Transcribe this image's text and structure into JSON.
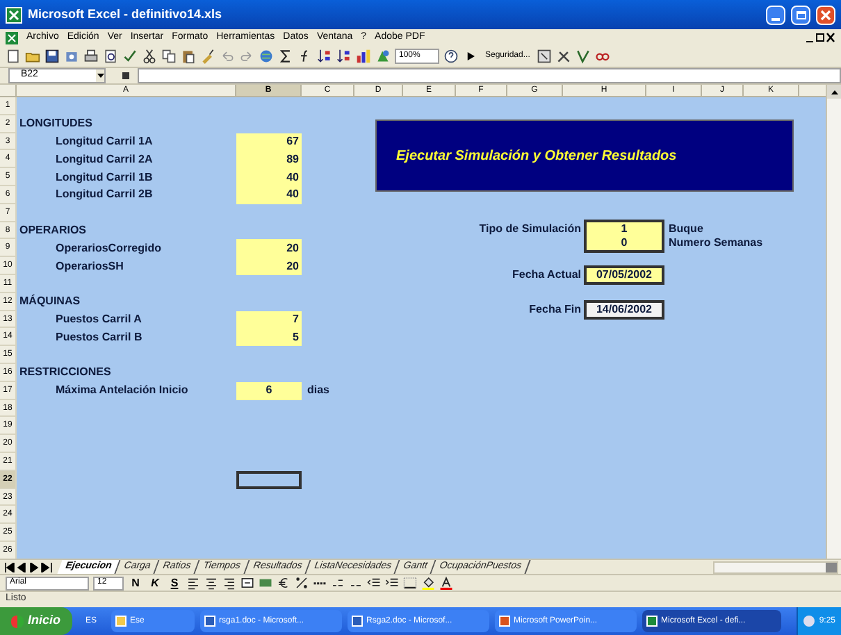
{
  "window": {
    "title": "Microsoft Excel - definitivo14.xls"
  },
  "menu": [
    "Archivo",
    "Edición",
    "Ver",
    "Insertar",
    "Formato",
    "Herramientas",
    "Datos",
    "Ventana",
    "?",
    "Adobe PDF"
  ],
  "toolbar": {
    "zoom": "100%",
    "security": "Seguridad..."
  },
  "formula_bar": {
    "name_box": "B22"
  },
  "columns": [
    {
      "label": "A",
      "selected": false
    },
    {
      "label": "B",
      "selected": true
    },
    {
      "label": "C",
      "selected": false
    },
    {
      "label": "D",
      "selected": false
    },
    {
      "label": "E",
      "selected": false
    },
    {
      "label": "F",
      "selected": false
    },
    {
      "label": "G",
      "selected": false
    },
    {
      "label": "H",
      "selected": false
    },
    {
      "label": "I",
      "selected": false
    },
    {
      "label": "J",
      "selected": false
    },
    {
      "label": "K",
      "selected": false
    }
  ],
  "rows": [
    {
      "number": "1",
      "selected": false
    },
    {
      "number": "2",
      "selected": false,
      "label": "LONGITUDES",
      "kind": "heading"
    },
    {
      "number": "3",
      "selected": false,
      "label": "Longitud Carril 1A",
      "kind": "item",
      "value": "67"
    },
    {
      "number": "4",
      "selected": false,
      "label": "Longitud Carril 2A",
      "kind": "item",
      "value": "89"
    },
    {
      "number": "5",
      "selected": false,
      "label": "Longitud Carril 1B",
      "kind": "item",
      "value": "40"
    },
    {
      "number": "6",
      "selected": false,
      "label": "Longitud Carril 2B",
      "kind": "item",
      "value": "40"
    },
    {
      "number": "7",
      "selected": false
    },
    {
      "number": "8",
      "selected": false,
      "label": "OPERARIOS",
      "kind": "heading"
    },
    {
      "number": "9",
      "selected": false,
      "label": "OperariosCorregido",
      "kind": "item",
      "value": "20"
    },
    {
      "number": "10",
      "selected": false,
      "label": "OperariosSH",
      "kind": "item",
      "value": "20"
    },
    {
      "number": "11",
      "selected": false
    },
    {
      "number": "12",
      "selected": false,
      "label": "MÁQUINAS",
      "kind": "heading"
    },
    {
      "number": "13",
      "selected": false,
      "label": "Puestos Carril A",
      "kind": "item",
      "value": "7"
    },
    {
      "number": "14",
      "selected": false,
      "label": "Puestos Carril B",
      "kind": "item",
      "value": "5"
    },
    {
      "number": "15",
      "selected": false
    },
    {
      "number": "16",
      "selected": false,
      "label": "RESTRICCIONES",
      "kind": "heading"
    },
    {
      "number": "17",
      "selected": false,
      "label": "Máxima Antelación Inicio",
      "kind": "item",
      "value": "6",
      "unit": "dias"
    },
    {
      "number": "18",
      "selected": false
    },
    {
      "number": "19",
      "selected": false
    },
    {
      "number": "20",
      "selected": false
    },
    {
      "number": "21",
      "selected": false
    },
    {
      "number": "22",
      "selected": true
    },
    {
      "number": "23",
      "selected": false
    },
    {
      "number": "24",
      "selected": false
    },
    {
      "number": "25",
      "selected": false
    },
    {
      "number": "26",
      "selected": false
    }
  ],
  "run_button": {
    "label": "Ejecutar Simulación y Obtener Resultados"
  },
  "fields": [
    {
      "label": "Tipo de Simulación",
      "values": [
        "1",
        "0"
      ],
      "notes": [
        "Buque",
        "Numero Semanas"
      ],
      "editable": true
    },
    {
      "label": "Fecha Actual",
      "values": [
        "07/05/2002"
      ],
      "editable": true
    },
    {
      "label": "Fecha Fin",
      "values": [
        "14/06/2002"
      ],
      "editable": false
    }
  ],
  "sheet_tabs": [
    {
      "label": "Ejecucion",
      "selected": true
    },
    {
      "label": "Carga",
      "selected": false
    },
    {
      "label": "Ratios",
      "selected": false
    },
    {
      "label": "Tiempos",
      "selected": false
    },
    {
      "label": "Resultados",
      "selected": false
    },
    {
      "label": "ListaNecesidades",
      "selected": false
    },
    {
      "label": "Gantt",
      "selected": false
    },
    {
      "label": "OcupaciónPuestos",
      "selected": false
    }
  ],
  "format_toolbar": {
    "font": "Arial",
    "size": "12",
    "style_buttons": [
      "N",
      "K",
      "S"
    ]
  },
  "status_bar": {
    "text": "Listo"
  },
  "taskbar": {
    "start": "Inicio",
    "language": "ES",
    "items": [
      {
        "label": "Ese",
        "kind": "folder",
        "selected": false
      },
      {
        "label": "rsga1.doc - Microsoft...",
        "kind": "word",
        "selected": false
      },
      {
        "label": "Rsga2.doc - Microsof...",
        "kind": "word",
        "selected": false
      },
      {
        "label": "Microsoft PowerPoin...",
        "kind": "powerpoint",
        "selected": false
      },
      {
        "label": "Microsoft Excel - defi...",
        "kind": "excel",
        "selected": true
      }
    ],
    "clock": "9:25"
  }
}
